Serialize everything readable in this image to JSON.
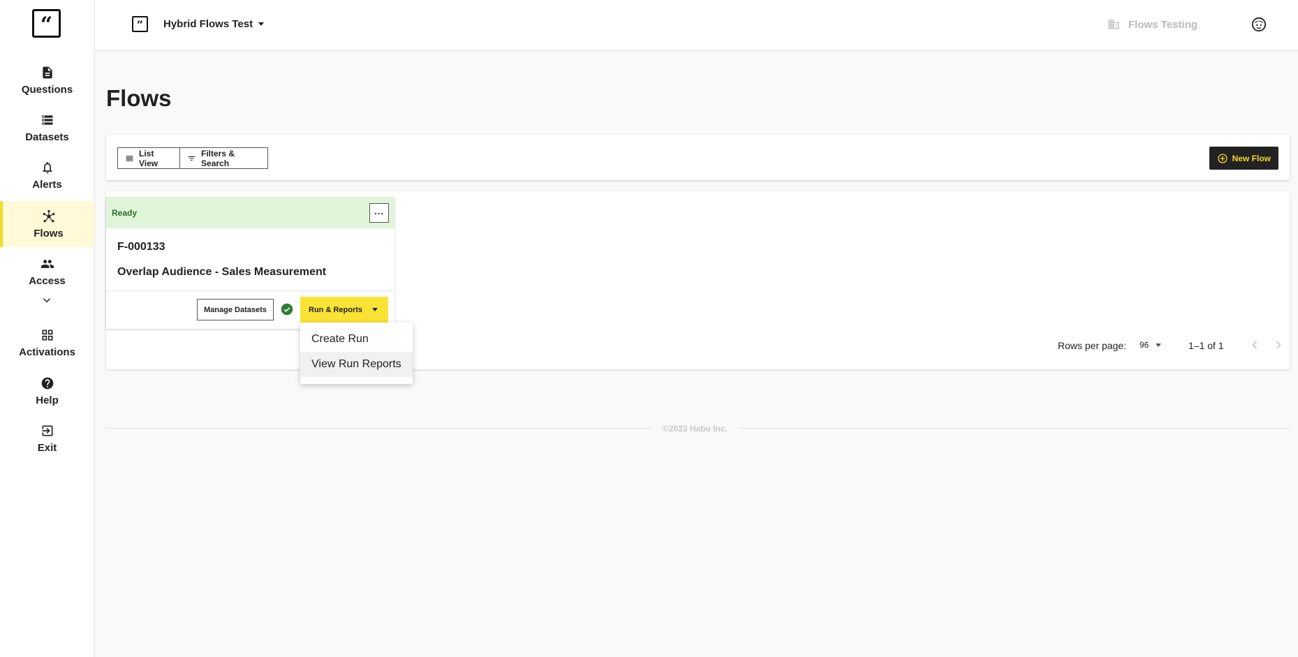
{
  "sidebar": {
    "logo_icon": "habu-logo-icon",
    "items": [
      {
        "label": "Questions",
        "icon": "document-icon"
      },
      {
        "label": "Datasets",
        "icon": "list-icon"
      },
      {
        "label": "Alerts",
        "icon": "bell-icon"
      },
      {
        "label": "Flows",
        "icon": "flow-icon",
        "active": true
      },
      {
        "label": "Access",
        "icon": "people-icon"
      },
      {
        "label": "Activations",
        "icon": "grid-icon"
      },
      {
        "label": "Help",
        "icon": "help-icon"
      },
      {
        "label": "Exit",
        "icon": "exit-icon"
      }
    ]
  },
  "header": {
    "org_name": "Hybrid Flows Test",
    "project_name": "Flows Testing"
  },
  "page": {
    "title": "Flows"
  },
  "toolbar": {
    "list_view_label": "List View",
    "filters_label": "Filters & Search",
    "new_flow_label": "New Flow"
  },
  "flows": [
    {
      "status": "Ready",
      "id": "F-000133",
      "name": "Overlap Audience - Sales Measurement",
      "more_label": "...",
      "manage_label": "Manage Datasets",
      "run_label": "Run & Reports"
    }
  ],
  "dropdown": {
    "items": [
      "Create Run",
      "View Run Reports"
    ]
  },
  "pagination": {
    "rows_label": "Rows per page:",
    "rows_value": "96",
    "range": "1–1 of 1"
  },
  "footer": {
    "copyright": "©2023 Habu Inc."
  },
  "colors": {
    "accent": "#fbe335",
    "active_nav_bg": "#fff9d7",
    "status_bg": "#dff5d8",
    "status_text": "#2e6b2a",
    "dark_button": "#222222"
  }
}
